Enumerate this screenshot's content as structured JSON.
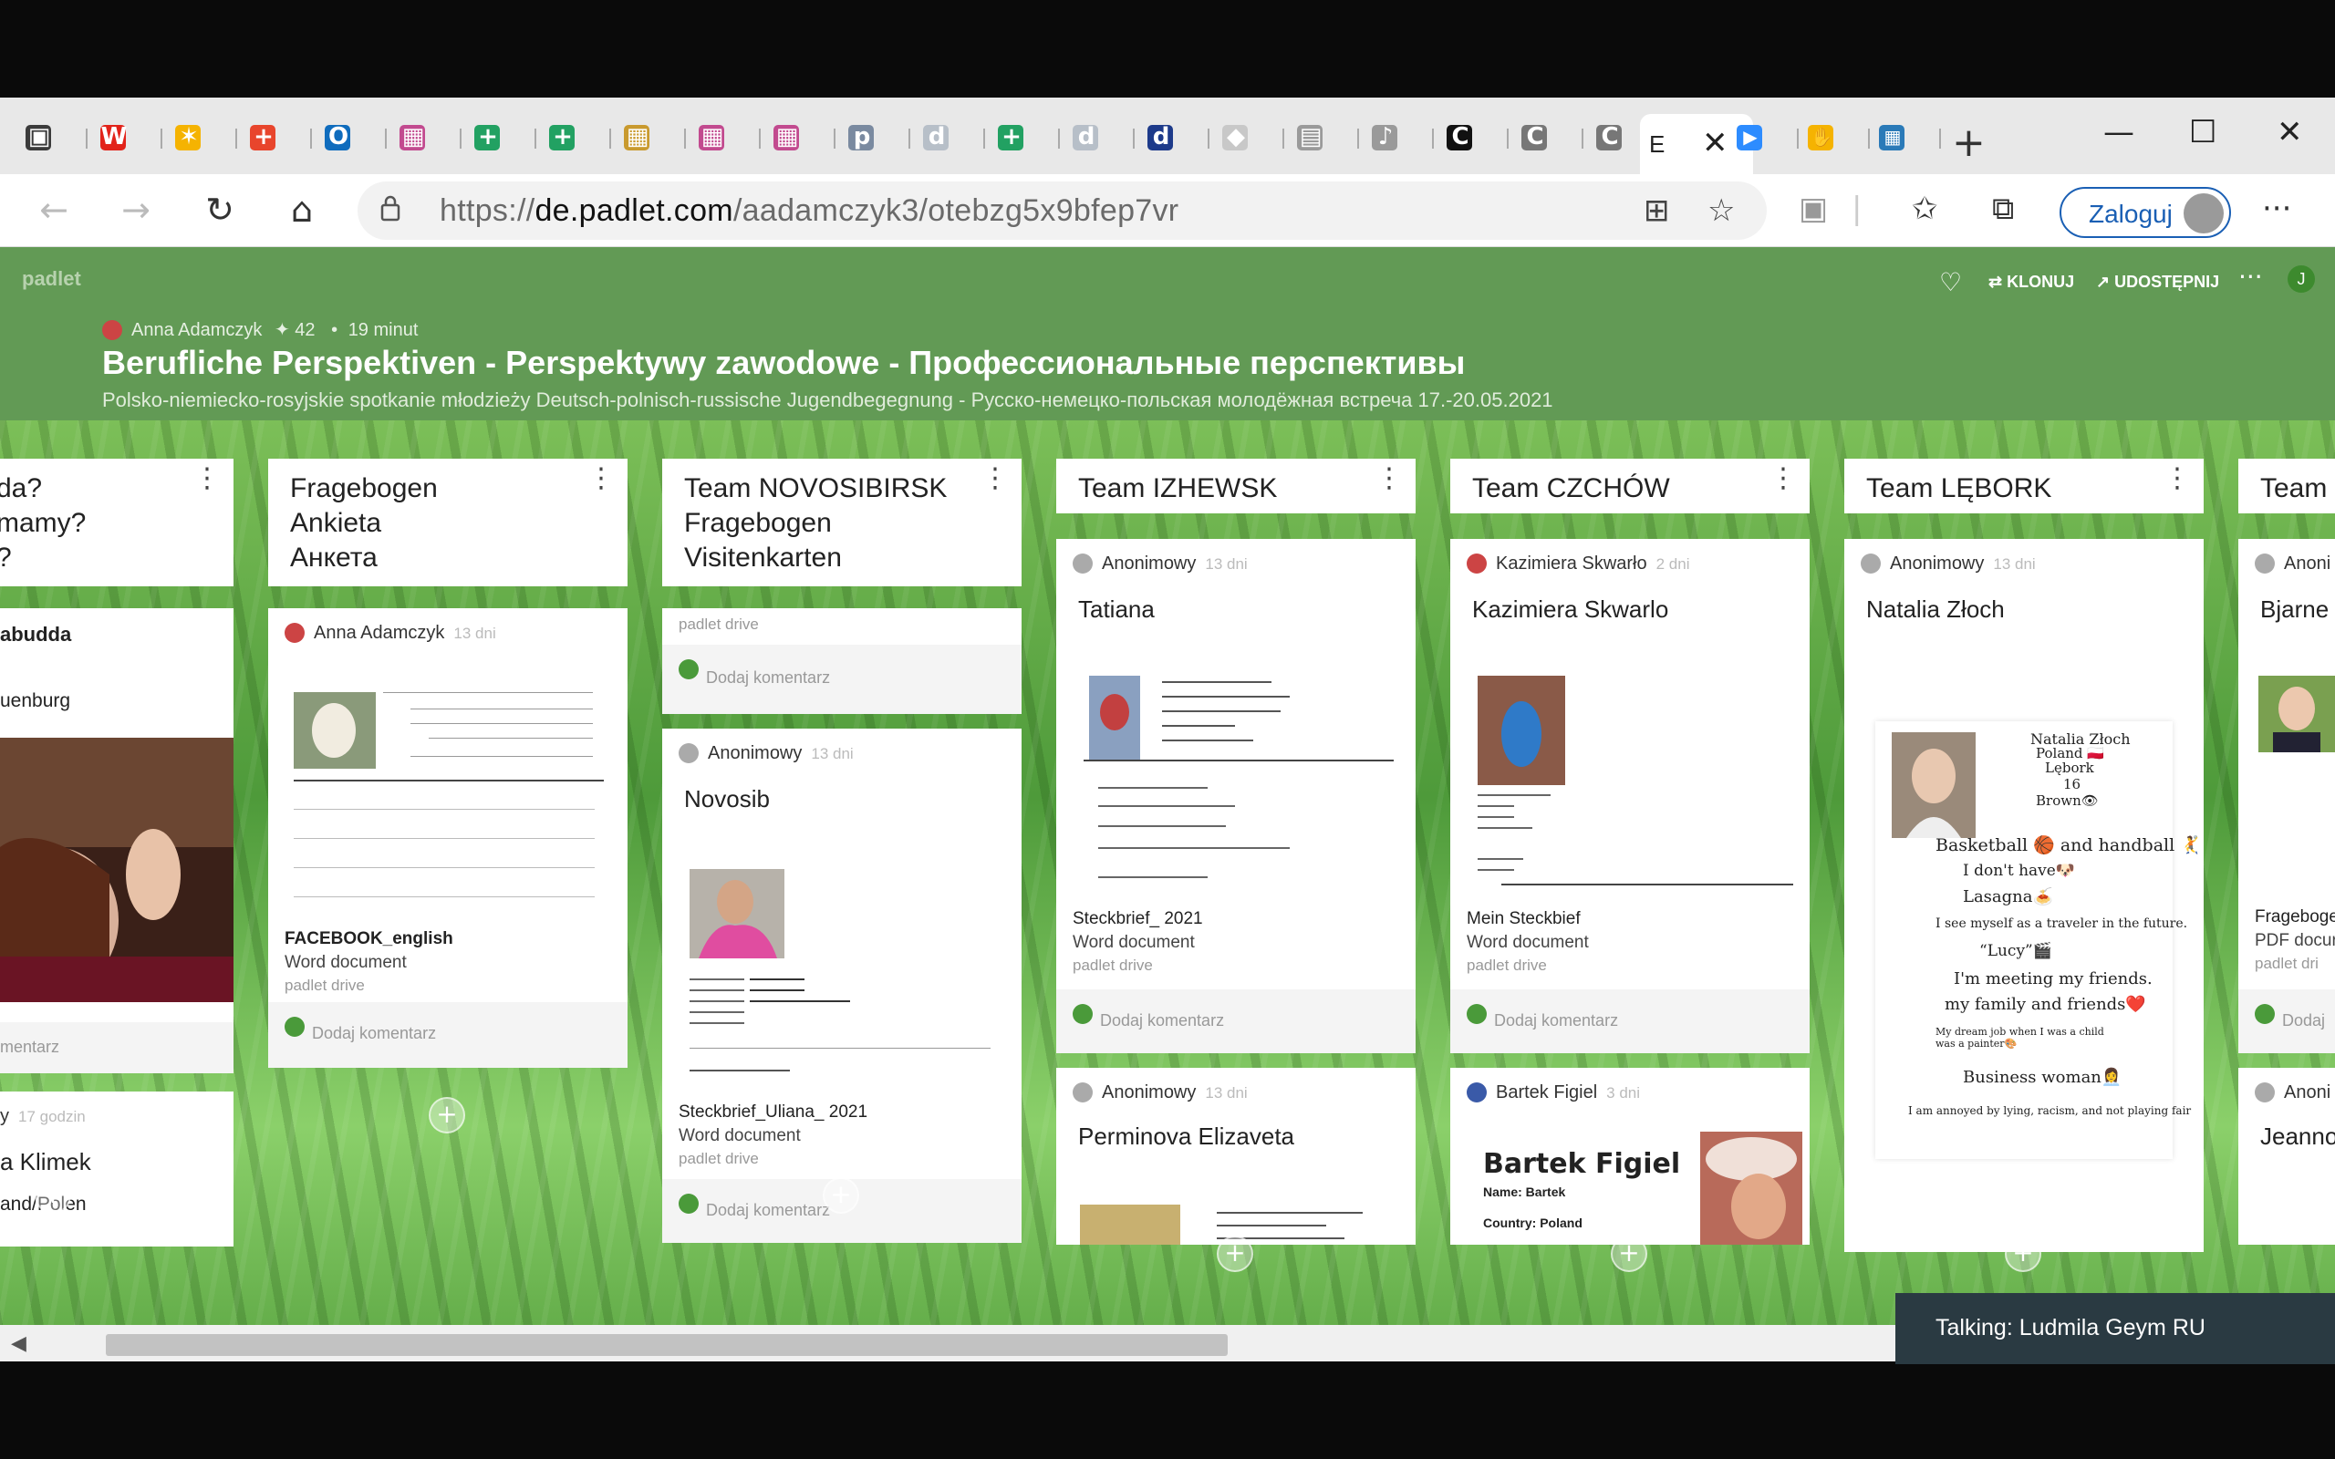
{
  "browser": {
    "tabs": [
      {
        "icon": "tabs-icon",
        "color": "#3b3b3b",
        "glyph": "▣"
      },
      {
        "icon": "wp-icon",
        "color": "#e2231a",
        "glyph": "W"
      },
      {
        "icon": "star-icon",
        "color": "#f5b301",
        "glyph": "✶"
      },
      {
        "icon": "plus-app-icon",
        "color": "#e8452c",
        "glyph": "+"
      },
      {
        "icon": "outlook-icon",
        "color": "#0f6cbd",
        "glyph": "O"
      },
      {
        "icon": "padlet-icon",
        "color": "#c24a8f",
        "glyph": "▦"
      },
      {
        "icon": "sheets-icon",
        "color": "#22a162",
        "glyph": "+"
      },
      {
        "icon": "sheets-icon",
        "color": "#22a162",
        "glyph": "+"
      },
      {
        "icon": "padlet-icon",
        "color": "#c99a2e",
        "glyph": "▦"
      },
      {
        "icon": "padlet-icon",
        "color": "#c24a8f",
        "glyph": "▦"
      },
      {
        "icon": "padlet-icon",
        "color": "#c24a8f",
        "glyph": "▦"
      },
      {
        "icon": "pnwm-icon",
        "color": "#7a8aa0",
        "glyph": "p"
      },
      {
        "icon": "d-icon",
        "color": "#b7bfc8",
        "glyph": "d"
      },
      {
        "icon": "sheets-icon",
        "color": "#22a162",
        "glyph": "+"
      },
      {
        "icon": "d-icon",
        "color": "#b7bfc8",
        "glyph": "d"
      },
      {
        "icon": "d-icon",
        "color": "#1d3a8a",
        "glyph": "d"
      },
      {
        "icon": "diamond-icon",
        "color": "#c8c8c8",
        "glyph": "◆"
      },
      {
        "icon": "doc-icon",
        "color": "#9a9a9a",
        "glyph": "▤"
      },
      {
        "icon": "music-icon",
        "color": "#9a9a9a",
        "glyph": "♪"
      },
      {
        "icon": "c-icon",
        "color": "#111111",
        "glyph": "C"
      },
      {
        "icon": "c-icon",
        "color": "#777777",
        "glyph": "C"
      },
      {
        "icon": "c-icon",
        "color": "#777777",
        "glyph": "C"
      }
    ],
    "active_tab": {
      "label": "E",
      "close": "✕"
    },
    "right_tabs": [
      {
        "icon": "zoom-icon",
        "color": "#2d8cff",
        "glyph": "▶"
      },
      {
        "icon": "hand-icon",
        "color": "#f5b301",
        "glyph": "✋"
      },
      {
        "icon": "map-icon",
        "color": "#2a7ab8",
        "glyph": "▦"
      }
    ],
    "new_tab": "+",
    "window": {
      "minimize": "—",
      "maximize": "☐",
      "close": "✕"
    },
    "url_prefix": "https://",
    "url_host": "de.padlet.com",
    "url_path": "/aadamczyk3/otebzg5x9bfep7vr",
    "signin_label": "Zaloguj",
    "more": "···"
  },
  "padlet": {
    "brand": "padlet",
    "author": "Anna Adamczyk",
    "likes": "✦ 42",
    "time": "19 minut",
    "title": "Berufliche Perspektiven - Perspektywy zawodowe - Профессиональные перспективы",
    "subtitle": "Polsko-niemiecko-rosyjskie spotkanie młodzieży Deutsch-polnisch-russische Jugendbegegnung - Русско-немецко-польская молодёжная встреча 17.-20.05.2021",
    "actions": {
      "clone": "⇄ KLONUJ",
      "share": "↗ UDOSTĘPNIJ",
      "user": "J"
    }
  },
  "columns": [
    {
      "title": "da?\nmamy?\n?",
      "cards": [
        {
          "author": "",
          "ago": "",
          "title": "abudda",
          "extra": "uenburg",
          "comment": "mentarz"
        },
        {
          "author": "y",
          "ago": "17 godzin",
          "title": "a Klimek",
          "extra": "and/Polen"
        }
      ]
    },
    {
      "title": "Fragebogen\nAnkieta\nАнкета",
      "cards": [
        {
          "author": "Anna Adamczyk",
          "ago": "13 dni",
          "fname": "FACEBOOK_english",
          "ftype": "Word document",
          "fsrc": "padlet drive",
          "comment": "Dodaj komentarz"
        }
      ]
    },
    {
      "title": "Team NOVOSIBIRSK\nFragebogen\nVisitenkarten",
      "cards": [
        {
          "fsrc": "padlet drive",
          "comment": "Dodaj komentarz"
        },
        {
          "author": "Anonimowy",
          "ago": "13 dni",
          "title": "Novosib",
          "fname": "Steckbrief_Uliana_ 2021",
          "ftype": "Word document",
          "fsrc": "padlet drive",
          "comment": "Dodaj komentarz"
        }
      ]
    },
    {
      "title": "Team IZHEWSK",
      "cards": [
        {
          "author": "Anonimowy",
          "ago": "13 dni",
          "title": "Tatiana",
          "fname": "Steckbrief_ 2021",
          "ftype": "Word document",
          "fsrc": "padlet drive",
          "comment": "Dodaj komentarz"
        },
        {
          "author": "Anonimowy",
          "ago": "13 dni",
          "title": "Perminova Elizaveta"
        }
      ]
    },
    {
      "title": "Team CZCHÓW",
      "cards": [
        {
          "author": "Kazimiera Skwarło",
          "ago": "2 dni",
          "title": "Kazimiera Skwarlo",
          "fname": "Mein Steckbief",
          "ftype": "Word document",
          "fsrc": "padlet drive",
          "comment": "Dodaj komentarz"
        },
        {
          "author": "Bartek Figiel",
          "ago": "3 dni",
          "doc_title": "Bartek Figiel",
          "doc_name": "Name: Bartek",
          "doc_country": "Country: Poland"
        }
      ]
    },
    {
      "title": "Team LĘBORK",
      "cards": [
        {
          "author": "Anonimowy",
          "ago": "13 dni",
          "title": "Natalia Złoch",
          "doc_lines": [
            "Natalia Złoch",
            "Poland 🇵🇱",
            "Lębork",
            "16",
            "Brown👁",
            "Basketball 🏀 and handball 🤾",
            "I don't have🐶",
            "Lasagna🍝",
            "I see myself as a traveler in the future.",
            "“Lucy”🎬",
            "I'm meeting my friends.",
            "my family and friends❤️",
            "My dream job when I was a child was a painter🎨",
            "Business woman👩‍💼",
            "I am annoyed by lying, racism, and not playing fair"
          ]
        }
      ]
    },
    {
      "title": "Team",
      "cards": [
        {
          "author": "Anoni",
          "title": "Bjarne",
          "fname": "Frageboge",
          "ftype": "PDF docur",
          "fsrc": "padlet dri",
          "comment": "Dodaj"
        },
        {
          "author": "Anoni",
          "title": "Jeanno"
        }
      ]
    }
  ],
  "scrollbar": {
    "left_arrow": "◀"
  },
  "talking": "Talking: Ludmila Geym RU"
}
